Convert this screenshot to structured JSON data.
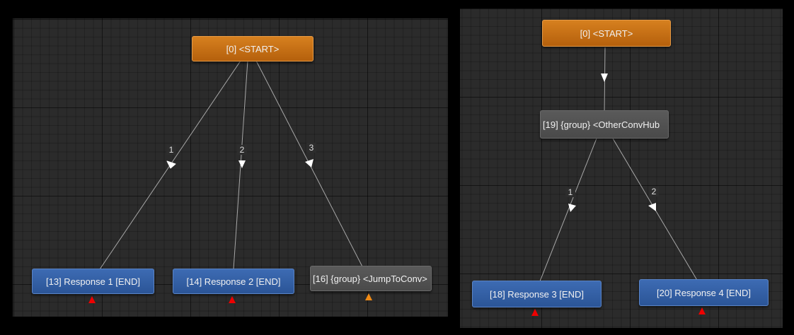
{
  "left_panel": {
    "start_node": "[0] <START>",
    "link_labels": [
      "1",
      "2",
      "3"
    ],
    "nodes": [
      "[13] Response 1 [END]",
      "[14] Response 2 [END]",
      "[16] {group} <JumpToConv>"
    ]
  },
  "right_panel": {
    "start_node": "[0] <START>",
    "hub_node": "[19] {group} <OtherConvHub",
    "link_labels": [
      "1",
      "2"
    ],
    "nodes": [
      "[18] Response 3 [END]",
      "[20] Response 4 [END]"
    ]
  },
  "colors": {
    "start": "#c8721a",
    "response": "#2f5c9f",
    "group": "#505050",
    "end_marker": "#ee0000",
    "link_marker": "#f08a14"
  }
}
